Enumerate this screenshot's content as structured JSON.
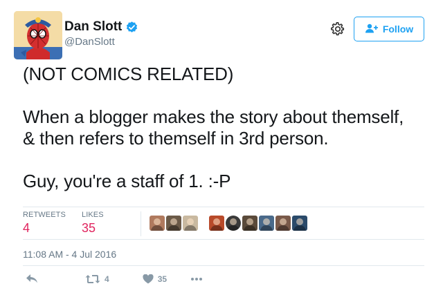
{
  "user": {
    "display_name": "Dan Slott",
    "handle": "@DanSlott",
    "verified": true
  },
  "follow_button": {
    "label": "Follow"
  },
  "tweet": {
    "text": "(NOT COMICS RELATED)\n\nWhen a blogger makes the story about themself,\n& then refers to themself in 3rd person.\n\nGuy, you're a staff of 1. :-P",
    "timestamp": "11:08 AM - 4 Jul 2016"
  },
  "stats": {
    "retweets_label": "RETWEETS",
    "retweets_value": "4",
    "likes_label": "LIKES",
    "likes_value": "35"
  },
  "liker_avatars": [
    {
      "name": "liker-avatar-1",
      "color": "#b07a5e"
    },
    {
      "name": "liker-avatar-2",
      "color": "#6b5a48"
    },
    {
      "name": "liker-avatar-3",
      "color": "#c9b9a0"
    },
    {
      "name": "liker-avatar-4",
      "color": "#b84a2a"
    },
    {
      "name": "liker-avatar-5",
      "color": "#3a3a3a"
    },
    {
      "name": "liker-avatar-6",
      "color": "#5a4a3a"
    },
    {
      "name": "liker-avatar-7",
      "color": "#4a6a8a"
    },
    {
      "name": "liker-avatar-8",
      "color": "#7a5a4a"
    },
    {
      "name": "liker-avatar-9",
      "color": "#2a4a6a"
    }
  ],
  "actions": {
    "reply_icon": "reply-icon",
    "retweet_count": "4",
    "like_count": "35",
    "more_icon": "more-icon"
  },
  "colors": {
    "accent": "#1da1f2",
    "like": "#e0245e",
    "muted": "#657786"
  }
}
